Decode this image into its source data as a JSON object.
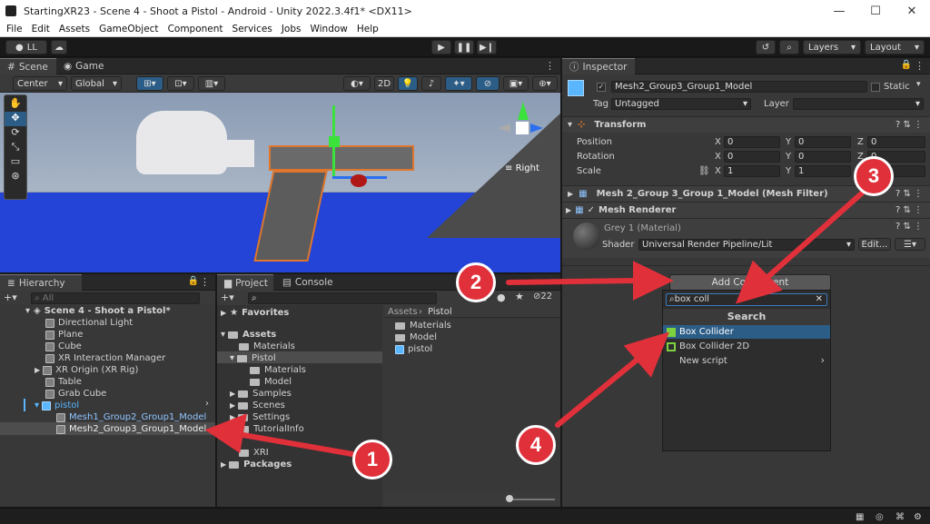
{
  "window": {
    "title": "StartingXR23 - Scene 4 - Shoot a Pistol - Android - Unity 2022.3.4f1* <DX11>",
    "minimize": "—",
    "maximize": "☐",
    "close": "✕"
  },
  "menu": [
    "File",
    "Edit",
    "Assets",
    "GameObject",
    "Component",
    "Services",
    "Jobs",
    "Window",
    "Help"
  ],
  "toolbar": {
    "account": "LL",
    "play": "▶",
    "pause": "❚❚",
    "step": "▶❙",
    "layers": "Layers",
    "layout": "Layout"
  },
  "scene": {
    "tabs": [
      "Scene",
      "Game"
    ],
    "pivot": "Center",
    "space": "Global",
    "mode2d": "2D",
    "gizmo_label": "Right"
  },
  "hierarchy": {
    "title": "Hierarchy",
    "search_placeholder": "All",
    "scene_name": "Scene 4 - Shoot a Pistol*",
    "items": [
      {
        "label": "Directional Light"
      },
      {
        "label": "Plane"
      },
      {
        "label": "Cube"
      },
      {
        "label": "XR Interaction Manager"
      },
      {
        "label": "XR Origin (XR Rig)"
      },
      {
        "label": "Table"
      },
      {
        "label": "Grab Cube"
      },
      {
        "label": "pistol"
      },
      {
        "label": "Mesh1_Group2_Group1_Model"
      },
      {
        "label": "Mesh2_Group3_Group1_Model"
      }
    ]
  },
  "project": {
    "tabs": [
      "Project",
      "Console"
    ],
    "badge_count": "22",
    "favorites": "Favorites",
    "tree": [
      "Assets",
      "Materials",
      "Pistol",
      "Materials",
      "Model",
      "Samples",
      "Scenes",
      "Settings",
      "TutorialInfo",
      "XRI",
      "Packages"
    ],
    "breadcrumb": [
      "Assets",
      "Pistol"
    ],
    "files": [
      "Materials",
      "Model",
      "pistol"
    ]
  },
  "inspector": {
    "title": "Inspector",
    "object_name": "Mesh2_Group3_Group1_Model",
    "static_label": "Static",
    "tag_label": "Tag",
    "tag_value": "Untagged",
    "layer_label": "Layer",
    "layer_value": "",
    "transform": "Transform",
    "position": {
      "label": "Position",
      "x": "0",
      "y": "0",
      "z": "0"
    },
    "rotation": {
      "label": "Rotation",
      "x": "0",
      "y": "0",
      "z": "0"
    },
    "scale": {
      "label": "Scale",
      "x": "1",
      "y": "1",
      "z": "1"
    },
    "mesh_filter": "Mesh 2_Group 3_Group 1_Model (Mesh Filter)",
    "mesh_renderer": "Mesh Renderer",
    "material_name": "Grey 1 (Material)",
    "shader_label": "Shader",
    "shader_value": "Universal Render Pipeline/Lit",
    "edit_label": "Edit...",
    "add_component": "Add Component"
  },
  "popup": {
    "search_value": "box coll",
    "header": "Search",
    "items": [
      "Box Collider",
      "Box Collider 2D",
      "New script"
    ]
  },
  "annotations": [
    "1",
    "2",
    "3",
    "4"
  ],
  "colors": {
    "arrow": "#e0303a",
    "selection": "#2c5d87",
    "accent": "#59b6ff"
  }
}
